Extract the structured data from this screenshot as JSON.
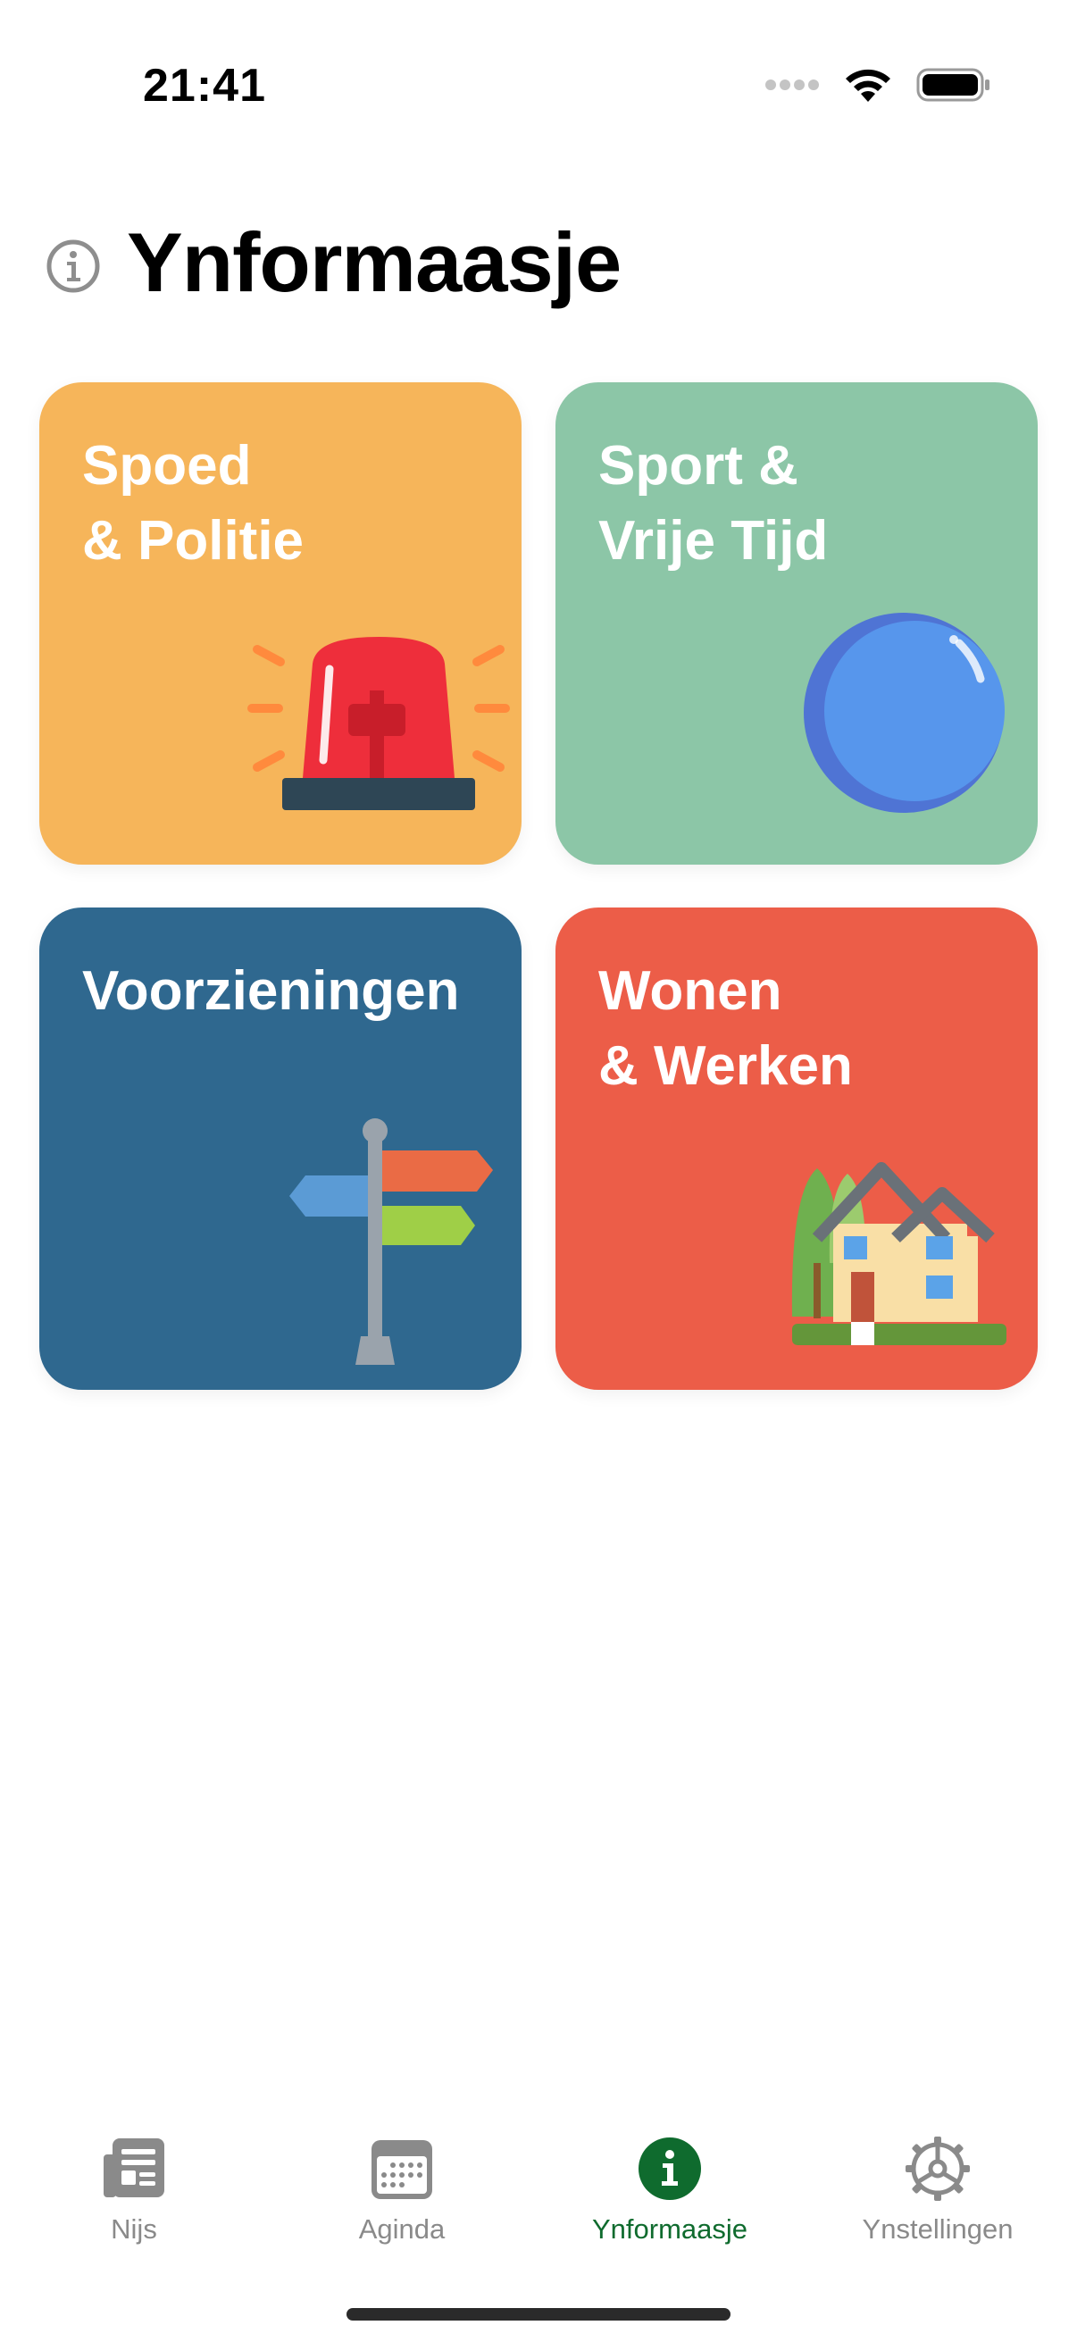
{
  "status_bar": {
    "time": "21:41"
  },
  "header": {
    "title": "Ynformaasje"
  },
  "cards": [
    {
      "title": "Spoed\n& Politie",
      "color": "#F6B55A",
      "icon": "siren-icon"
    },
    {
      "title": "Sport &\nVrije Tijd",
      "color": "#8CC6A7",
      "icon": "ball-icon"
    },
    {
      "title": "Voorzieningen",
      "color": "#2F688F",
      "icon": "signpost-icon"
    },
    {
      "title": "Wonen\n& Werken",
      "color": "#EC5D48",
      "icon": "house-icon"
    }
  ],
  "tab_bar": {
    "active_color": "#0F6B2E",
    "inactive_color": "#8A8A8A",
    "tabs": [
      {
        "label": "Nijs",
        "icon": "newspaper-icon",
        "active": false
      },
      {
        "label": "Aginda",
        "icon": "calendar-icon",
        "active": false
      },
      {
        "label": "Ynformaasje",
        "icon": "info-icon",
        "active": true
      },
      {
        "label": "Ynstellingen",
        "icon": "gear-icon",
        "active": false
      }
    ]
  }
}
